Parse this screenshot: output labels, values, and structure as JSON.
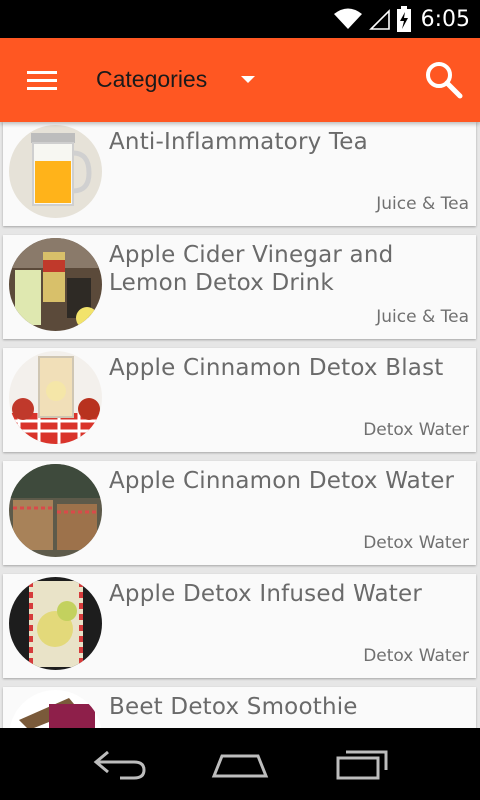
{
  "status_bar": {
    "time": "6:05",
    "icons": [
      "wifi-icon",
      "signal-icon",
      "battery-charging-icon"
    ]
  },
  "app_bar": {
    "title": "Categories",
    "menu_icon": "hamburger-menu-icon",
    "dropdown_icon": "dropdown-caret-icon",
    "search_icon": "search-icon",
    "color": "#ff5722"
  },
  "recipes": [
    {
      "title": "Anti-Inflammatory Tea",
      "category": "Juice & Tea"
    },
    {
      "title": "Apple Cider Vinegar and Lemon Detox Drink",
      "category": "Juice & Tea"
    },
    {
      "title": "Apple Cinnamon Detox Blast",
      "category": "Detox Water"
    },
    {
      "title": "Apple Cinnamon Detox Water",
      "category": "Detox Water"
    },
    {
      "title": "Apple Detox Infused Water",
      "category": "Detox Water"
    },
    {
      "title": "Beet Detox Smoothie",
      "category": ""
    }
  ],
  "nav_bar": {
    "icons": [
      "back-icon",
      "home-icon",
      "recent-apps-icon"
    ]
  }
}
